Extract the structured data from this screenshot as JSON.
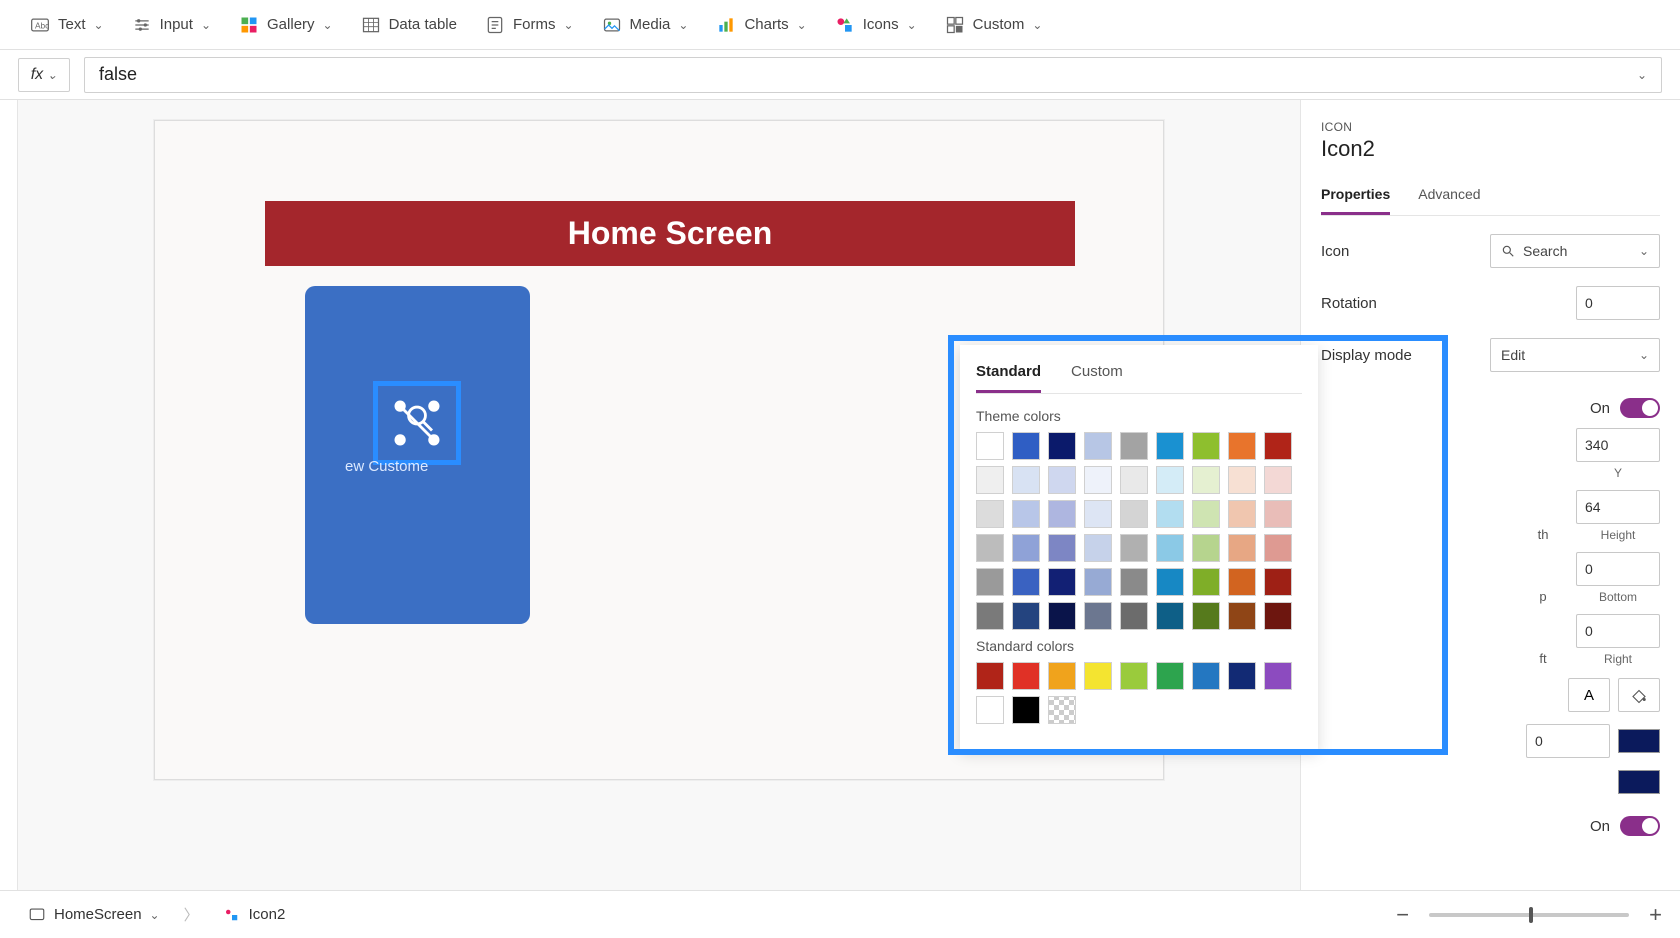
{
  "ribbon": {
    "text": "Text",
    "input": "Input",
    "gallery": "Gallery",
    "data_table": "Data table",
    "forms": "Forms",
    "media": "Media",
    "charts": "Charts",
    "icons": "Icons",
    "custom": "Custom"
  },
  "formula": {
    "fx": "fx",
    "value": "false"
  },
  "canvas": {
    "header": "Home Screen",
    "card_caption": "ew Custome"
  },
  "props": {
    "kind": "ICON",
    "name": "Icon2",
    "tab_properties": "Properties",
    "tab_advanced": "Advanced",
    "icon_label": "Icon",
    "icon_value": "Search",
    "rotation_label": "Rotation",
    "rotation_value": "0",
    "display_mode_label": "Display mode",
    "display_mode_value": "Edit",
    "toggle_on": "On",
    "y_value": "340",
    "y_label": "Y",
    "height_value": "64",
    "height_label": "Height",
    "p_label": "p",
    "bottom_label": "Bottom",
    "bottom_value": "0",
    "ft_label": "ft",
    "right_label": "Right",
    "right_value": "0",
    "A_label": "A",
    "num_zero": "0"
  },
  "color_picker": {
    "tab_standard": "Standard",
    "tab_custom": "Custom",
    "theme_label": "Theme colors",
    "standard_label": "Standard colors",
    "theme_rows": [
      [
        "#ffffff",
        "#2f5ec4",
        "#0b1a6b",
        "#b7c6e5",
        "#a3a3a3",
        "#1a91d1",
        "#8ebf2e",
        "#e8742c",
        "#b02418"
      ],
      [
        "#efefef",
        "#d8e2f3",
        "#cfd7ef",
        "#eef2fa",
        "#e9e9e9",
        "#d4ecf7",
        "#e5f0d1",
        "#f7e0d3",
        "#f3d8d5"
      ],
      [
        "#dcdcdc",
        "#b8c6e8",
        "#aeb6e0",
        "#dde5f4",
        "#d4d4d4",
        "#b2ddf0",
        "#cfe4b2",
        "#f0c6af",
        "#e9bdb8"
      ],
      [
        "#bcbcbc",
        "#8fa2d7",
        "#7d86c4",
        "#c6d2ea",
        "#b0b0b0",
        "#8bc9e6",
        "#b6d48e",
        "#e7a784",
        "#de9a92"
      ],
      [
        "#9a9a9a",
        "#3a62c1",
        "#122074",
        "#97aad4",
        "#8a8a8a",
        "#1788c4",
        "#7fae28",
        "#d26420",
        "#9e2015"
      ],
      [
        "#7a7a7a",
        "#24447f",
        "#0a144a",
        "#6c7790",
        "#6c6c6c",
        "#0e5f87",
        "#567a1c",
        "#8f4516",
        "#6d160f"
      ]
    ],
    "standard_row": [
      "#b02418",
      "#e03126",
      "#f0a31c",
      "#f4e430",
      "#9acb3c",
      "#2da44e",
      "#2477c1",
      "#122a74",
      "#8c4bbf"
    ],
    "extra_row": [
      "#ffffff",
      "#000000",
      "transparent"
    ]
  },
  "status": {
    "screen": "HomeScreen",
    "element": "Icon2"
  }
}
